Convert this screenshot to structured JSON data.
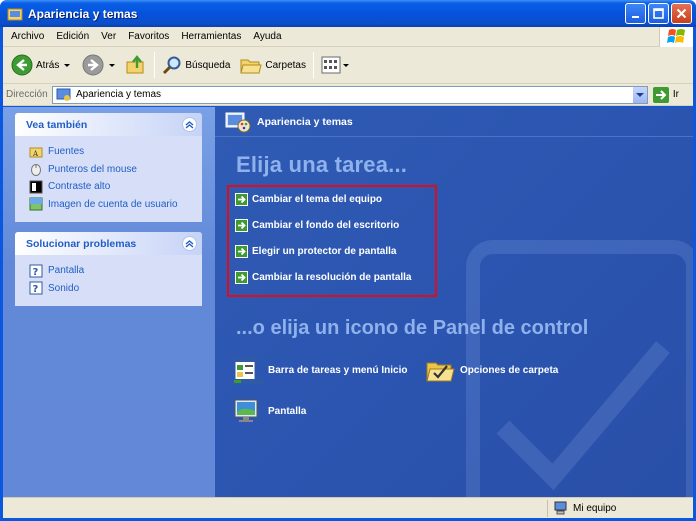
{
  "window": {
    "title": "Apariencia y temas"
  },
  "menubar": {
    "items": [
      "Archivo",
      "Edición",
      "Ver",
      "Favoritos",
      "Herramientas",
      "Ayuda"
    ]
  },
  "toolbar": {
    "back": "Atrás",
    "search": "Búsqueda",
    "folders": "Carpetas"
  },
  "address": {
    "label": "Dirección",
    "value": "Apariencia y temas",
    "go": "Ir"
  },
  "sidebar": {
    "see_also": {
      "title": "Vea también",
      "items": [
        "Fuentes",
        "Punteros del mouse",
        "Contraste alto",
        "Imagen de cuenta de usuario"
      ]
    },
    "troubleshoot": {
      "title": "Solucionar problemas",
      "items": [
        "Pantalla",
        "Sonido"
      ]
    }
  },
  "main": {
    "header": "Apariencia y temas",
    "pick_task": "Elija una tarea...",
    "tasks": [
      "Cambiar el tema del equipo",
      "Cambiar el fondo del escritorio",
      "Elegir un protector de pantalla",
      "Cambiar la resolución de pantalla"
    ],
    "or_pick": "...o elija un icono de Panel de control",
    "icons": [
      "Barra de tareas y menú Inicio",
      "Opciones de carpeta",
      "Pantalla"
    ]
  },
  "statusbar": {
    "location": "Mi equipo"
  },
  "colors": {
    "title_blue": "#0553dd",
    "sidebar_link": "#215dc6",
    "highlight_box": "#e00c1a",
    "heading_light": "#8fb1ec"
  }
}
